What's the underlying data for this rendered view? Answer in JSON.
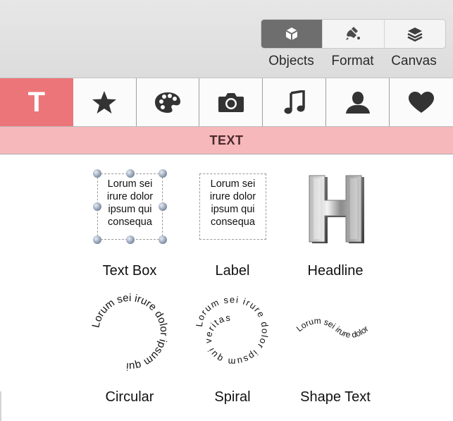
{
  "toolbar": {
    "buttons": [
      {
        "label": "Objects",
        "icon": "cube-icon",
        "active": true
      },
      {
        "label": "Format",
        "icon": "paint-brush-icon",
        "active": false
      },
      {
        "label": "Canvas",
        "icon": "layers-icon",
        "active": false
      }
    ]
  },
  "tabs": {
    "items": [
      {
        "name": "text",
        "icon": "T",
        "active": true
      },
      {
        "name": "shapes",
        "icon": "star-icon"
      },
      {
        "name": "colors",
        "icon": "palette-icon"
      },
      {
        "name": "photos",
        "icon": "camera-icon"
      },
      {
        "name": "music",
        "icon": "music-note-icon"
      },
      {
        "name": "people",
        "icon": "person-icon"
      },
      {
        "name": "favorites",
        "icon": "heart-icon"
      }
    ],
    "active_color": "#ec7579"
  },
  "section": {
    "title": "TEXT",
    "color": "#f7b8bb"
  },
  "items": [
    {
      "caption": "Text Box",
      "sample": "Lorum sei irure dolor ipsum qui consequa"
    },
    {
      "caption": "Label",
      "sample": "Lorum sei irure dolor ipsum qui consequa"
    },
    {
      "caption": "Headline",
      "sample": "H"
    },
    {
      "caption": "Circular",
      "sample": "Lorum sei irure dolor ipsum qui"
    },
    {
      "caption": "Spiral",
      "sample": "Lorum sei irure dolor ipsum qui veritas"
    },
    {
      "caption": "Shape Text",
      "sample": "Lorum sei irure dolor"
    }
  ]
}
